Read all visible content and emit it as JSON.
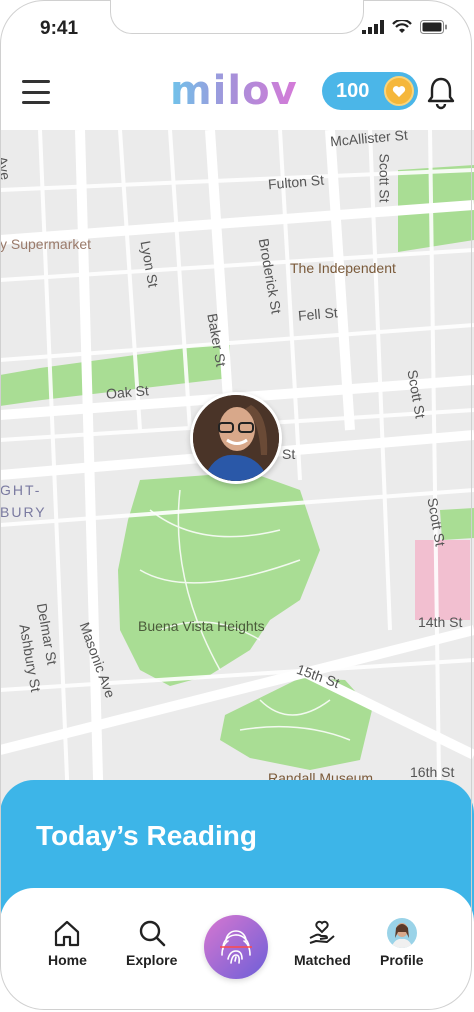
{
  "status": {
    "time": "9:41"
  },
  "header": {
    "logo": "milov",
    "coins": "100"
  },
  "map": {
    "streets": {
      "mcallister": "McAllister St",
      "fulton": "Fulton St",
      "scott_top": "Scott St",
      "supermarket": "y Supermarket",
      "lyon": "Lyon St",
      "broderick": "Broderick St",
      "independent": "The Independent",
      "fell": "Fell St",
      "baker": "Baker St",
      "oak": "Oak St",
      "scott_mid": "Scott St",
      "page": "St",
      "ght": "GHT-",
      "bury": "BURY",
      "scott_low": "Scott St",
      "delmar": "Delmar St",
      "masonic": "Masonic Ave",
      "ashbury": "Ashbury St",
      "buena_vista": "Buena Vista Heights",
      "fourteenth": "14th St",
      "fifteenth": "15th St",
      "randall": "Randall Museum",
      "sixteenth": "16th St",
      "ave": "Ave"
    }
  },
  "reading": {
    "title": "Today’s Reading"
  },
  "nav": {
    "home": "Home",
    "explore": "Explore",
    "matched": "Matched",
    "profile": "Profile"
  }
}
